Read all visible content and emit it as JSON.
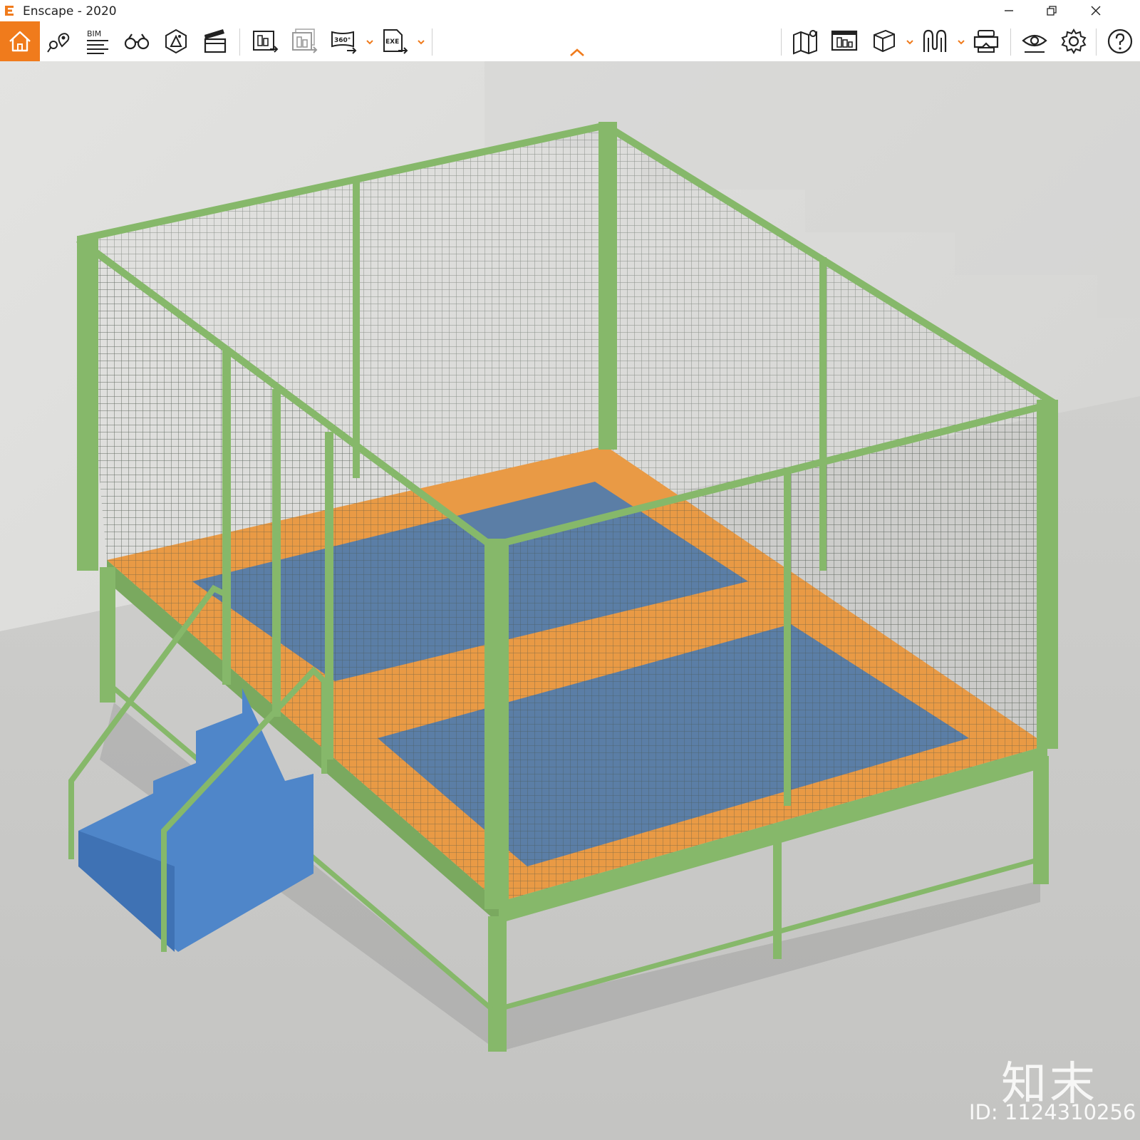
{
  "window": {
    "title": "Enscape - 2020",
    "minimize_label": "minimize",
    "restore_label": "restore",
    "close_label": "close"
  },
  "toolbar": {
    "accent_color": "#f07b1c",
    "left_tools": [
      {
        "icon": "home-icon",
        "active": true
      },
      {
        "icon": "location-pin-icon"
      },
      {
        "icon": "bim-icon",
        "label": "BIM"
      },
      {
        "icon": "binoculars-icon"
      },
      {
        "icon": "atmosphere-icon"
      },
      {
        "icon": "clapperboard-icon"
      },
      {
        "icon": "render-image-icon"
      },
      {
        "icon": "batch-render-icon"
      },
      {
        "icon": "panorama-360-icon",
        "label": "360°",
        "has_dropdown": true
      },
      {
        "icon": "export-exe-icon",
        "label": "EXE",
        "has_dropdown": true
      }
    ],
    "right_tools": [
      {
        "icon": "map-icon"
      },
      {
        "icon": "render-window-icon"
      },
      {
        "icon": "asset-cube-icon",
        "has_dropdown": true
      },
      {
        "icon": "material-icon",
        "has_dropdown": true
      },
      {
        "icon": "vr-headset-icon"
      },
      {
        "icon": "visual-settings-eye-icon"
      },
      {
        "icon": "settings-gear-icon"
      },
      {
        "icon": "help-icon"
      }
    ]
  },
  "viewport": {
    "scene": "green caged trampoline platform with blue stairs",
    "frame_color": "#86b86a",
    "pad_edge_color": "#e99a45",
    "pad_color": "#5b7ea6",
    "stairs_color": "#4f86c9"
  },
  "watermark": {
    "logo_text": "知末",
    "id_text": "ID: 1124310256"
  }
}
